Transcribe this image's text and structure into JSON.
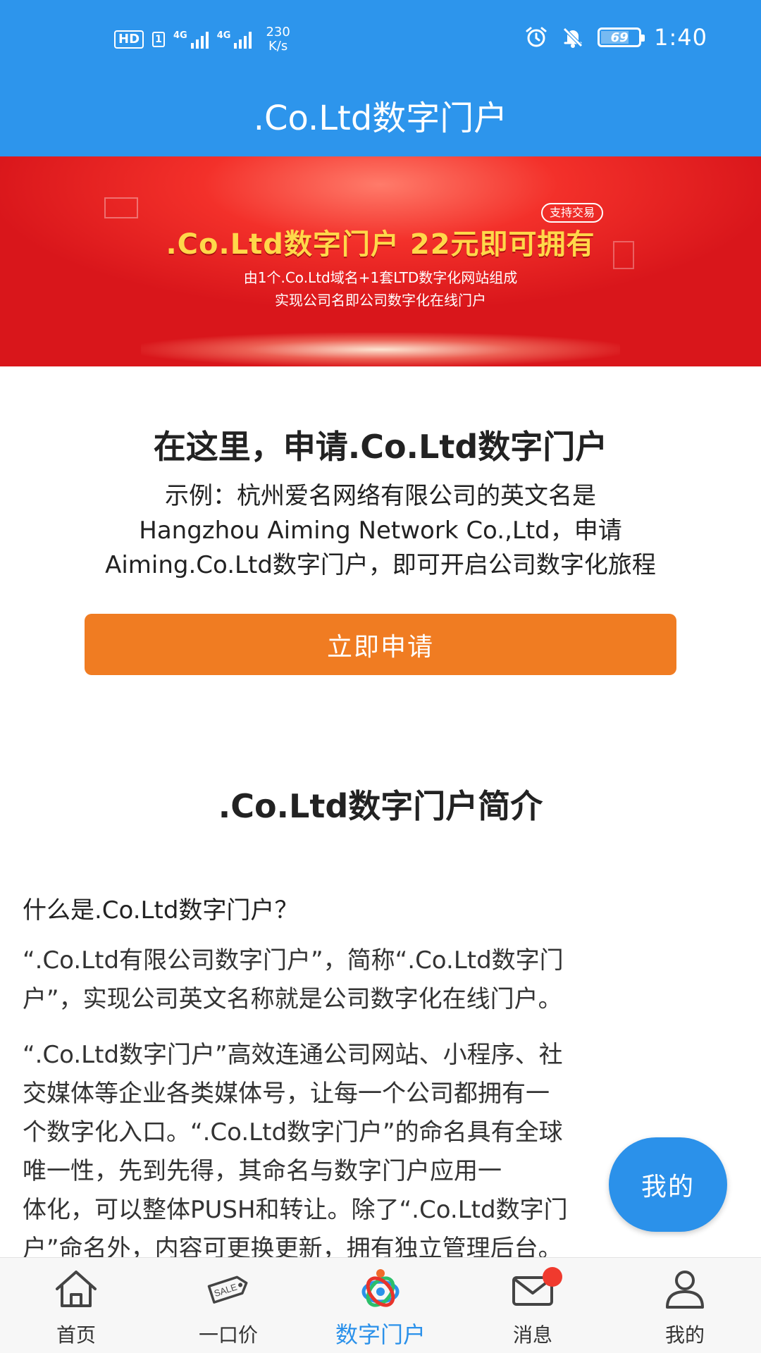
{
  "status_bar": {
    "hd": "HD",
    "sim": "1",
    "net1": "4G",
    "net2": "4G",
    "speed_value": "230",
    "speed_unit": "K/s",
    "battery_level": "69",
    "time": "1:40",
    "icons": [
      "alarm-icon",
      "mute-icon",
      "battery-icon"
    ]
  },
  "header": {
    "title": ".Co.Ltd数字门户"
  },
  "banner": {
    "title": ".Co.Ltd数字门户 22元即可拥有",
    "tag": "支持交易",
    "sub1": "由1个.Co.Ltd域名+1套LTD数字化网站组成",
    "sub2": "实现公司名即公司数字化在线门户"
  },
  "apply": {
    "title": "在这里，申请.Co.Ltd数字门户",
    "example_line1": "示例：杭州爱名网络有限公司的英文名是",
    "example_line2": "Hangzhou Aiming Network Co.,Ltd，申请",
    "example_line3": "Aiming.Co.Ltd数字门户，即可开启公司数字化旅程",
    "button_label": "立即申请"
  },
  "intro": {
    "title": ".Co.Ltd数字门户简介",
    "question": "什么是.Co.Ltd数字门户？",
    "para1_line1": "“.Co.Ltd有限公司数字门户”，简称“.Co.Ltd数字门",
    "para1_line2": "户”，实现公司英文名称就是公司数字化在线门户。",
    "para2_line1": "“.Co.Ltd数字门户”高效连通公司网站、小程序、社",
    "para2_line2": "交媒体等企业各类媒体号，让每一个公司都拥有一",
    "para2_line3": "个数字化入口。“.Co.Ltd数字门户”的命名具有全球",
    "para2_line4": "唯一性，先到先得，其命名与数字门户应用一",
    "para2_line5": "体化，可以整体PUSH和转让。除了“.Co.Ltd数字门",
    "para2_line6": "户”命名外，内容可更换更新，拥有独立管理后台。"
  },
  "fab": {
    "label": "我的"
  },
  "bottom_nav": {
    "items": [
      {
        "label": "首页",
        "icon": "home-icon"
      },
      {
        "label": "一口价",
        "icon": "sale-tag-icon"
      },
      {
        "label": "数字门户",
        "icon": "portal-icon"
      },
      {
        "label": "消息",
        "icon": "mail-icon"
      },
      {
        "label": "我的",
        "icon": "user-icon"
      }
    ],
    "active_index": 2
  },
  "colors": {
    "header_blue": "#2d95ec",
    "accent_orange": "#f07c22",
    "active_blue": "#2b91ea",
    "badge_red": "#f03a2e",
    "banner_red": "#e3201f",
    "banner_gold": "#ffd84a"
  }
}
